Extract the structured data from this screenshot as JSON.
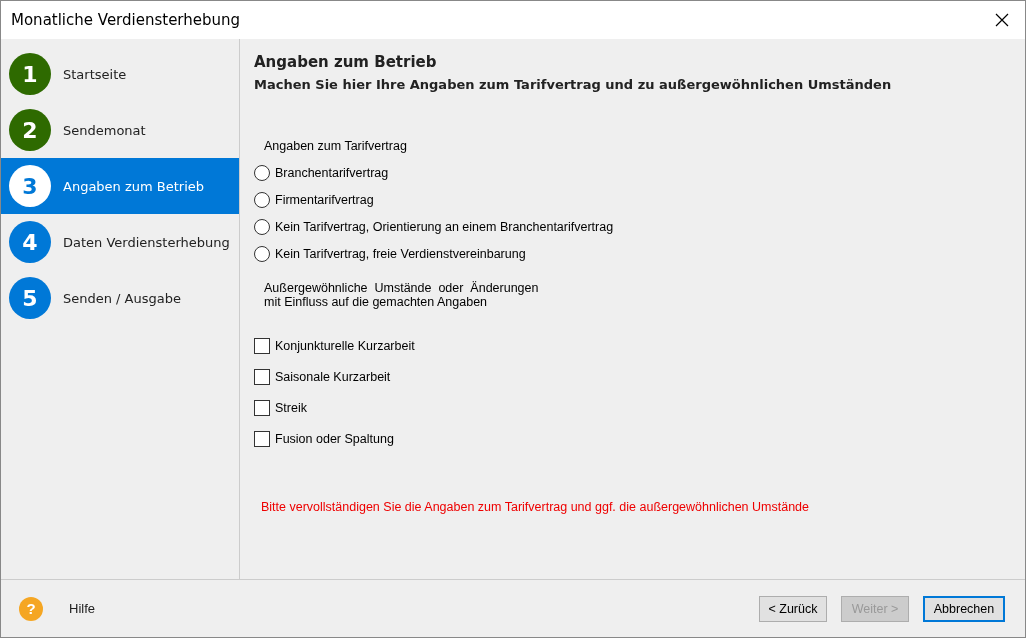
{
  "window": {
    "title": "Monatliche Verdiensterhebung"
  },
  "steps": [
    {
      "number": "1",
      "label": "Startseite",
      "kind": "done",
      "selected": false
    },
    {
      "number": "2",
      "label": "Sendemonat",
      "kind": "done",
      "selected": false
    },
    {
      "number": "3",
      "label": "Angaben zum Betrieb",
      "kind": "current",
      "selected": true
    },
    {
      "number": "4",
      "label": "Daten Verdiensterhebung",
      "kind": "pending",
      "selected": false
    },
    {
      "number": "5",
      "label": "Senden / Ausgabe",
      "kind": "pending",
      "selected": false
    }
  ],
  "page": {
    "heading": "Angaben zum Betrieb",
    "subheading": "Machen Sie hier Ihre Angaben zum Tarifvertrag und zu außergewöhnlichen Umständen"
  },
  "tariff": {
    "label": "Angaben zum Tarifvertrag",
    "options": [
      {
        "label": "Branchentarifvertrag",
        "selected": false
      },
      {
        "label": "Firmentarifvertrag",
        "selected": false
      },
      {
        "label": "Kein Tarifvertrag, Orientierung an einem Branchentarifvertrag",
        "selected": false
      },
      {
        "label": "Kein Tarifvertrag, freie Verdienstvereinbarung",
        "selected": false
      }
    ]
  },
  "circumstances": {
    "label_lines": [
      "Außergewöhnliche  Umstände  oder  Änderungen",
      "mit Einfluss auf die gemachten Angaben"
    ],
    "options": [
      {
        "label": "Konjunkturelle Kurzarbeit",
        "checked": false
      },
      {
        "label": "Saisonale Kurzarbeit",
        "checked": false
      },
      {
        "label": "Streik",
        "checked": false
      },
      {
        "label": "Fusion oder Spaltung",
        "checked": false
      }
    ]
  },
  "error_message": "Bitte vervollständigen Sie die Angaben zum Tarifvertrag und ggf. die außergewöhnlichen Umstände",
  "footer": {
    "help_icon": "?",
    "help": "Hilfe",
    "buttons": [
      {
        "label": "< Zurück",
        "disabled": false,
        "focused": false
      },
      {
        "label": "Weiter >",
        "disabled": true,
        "focused": false
      },
      {
        "label": "Abbrechen",
        "disabled": false,
        "focused": true
      }
    ]
  }
}
